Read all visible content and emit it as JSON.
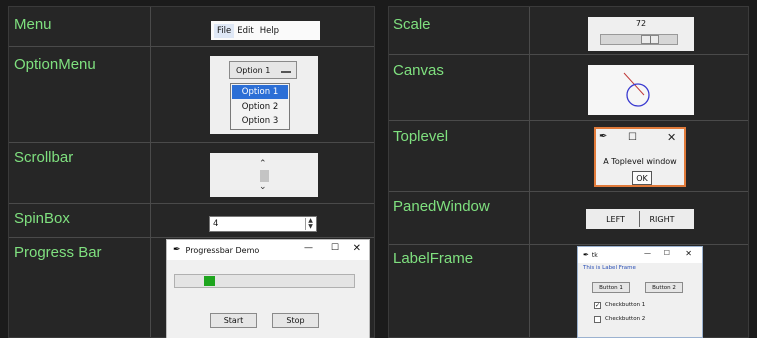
{
  "left_rows": {
    "menu": "Menu",
    "optionmenu": "OptionMenu",
    "scrollbar": "Scrollbar",
    "spinbox": "SpinBox",
    "progressbar": "Progress Bar"
  },
  "right_rows": {
    "scale": "Scale",
    "canvas": "Canvas",
    "toplevel": "Toplevel",
    "panedwindow": "PanedWindow",
    "labelframe": "LabelFrame"
  },
  "menu_demo": {
    "items": [
      "File",
      "Edit",
      "Help"
    ]
  },
  "optionmenu_demo": {
    "selected": "Option 1",
    "options": [
      "Option 1",
      "Option 2",
      "Option 3"
    ],
    "highlight_color": "#2c6fd6"
  },
  "spinbox_demo": {
    "value": "4"
  },
  "progress_demo": {
    "title": "Progressbar Demo",
    "start": "Start",
    "stop": "Stop",
    "bar_color": "#1ea51e"
  },
  "scale_demo": {
    "value": "72"
  },
  "toplevel_demo": {
    "message": "A Toplevel window",
    "ok": "OK",
    "border_color": "#e07a3a"
  },
  "paned_demo": {
    "left": "LEFT",
    "right": "RIGHT"
  },
  "labelframe_demo": {
    "title": "tk",
    "frame_label": "This is Label Frame",
    "button1": "Button 1",
    "button2": "Button 2",
    "check1": "Checkbutton 1",
    "check2": "Checkbutton 2"
  }
}
